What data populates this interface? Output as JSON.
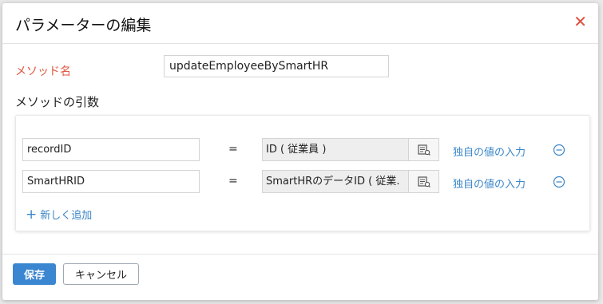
{
  "dialog": {
    "title": "パラメーターの編集",
    "close_icon": "close-icon"
  },
  "method": {
    "label": "メソッド名",
    "value": "updateEmployeeBySmartHR"
  },
  "arguments": {
    "heading": "メソッドの引数",
    "rows": [
      {
        "name": "recordID",
        "equals": "=",
        "value": "ID ( 従業員 )",
        "custom_link": "独自の値の入力"
      },
      {
        "name": "SmartHRID",
        "equals": "=",
        "value": "SmartHRのデータID ( 従業.",
        "custom_link": "独自の値の入力"
      }
    ],
    "add_new_label": "新しく追加"
  },
  "footer": {
    "save_label": "保存",
    "cancel_label": "キャンセル"
  },
  "colors": {
    "accent": "#3a86d0",
    "required_label": "#e0553f",
    "close": "#e04f3d"
  }
}
